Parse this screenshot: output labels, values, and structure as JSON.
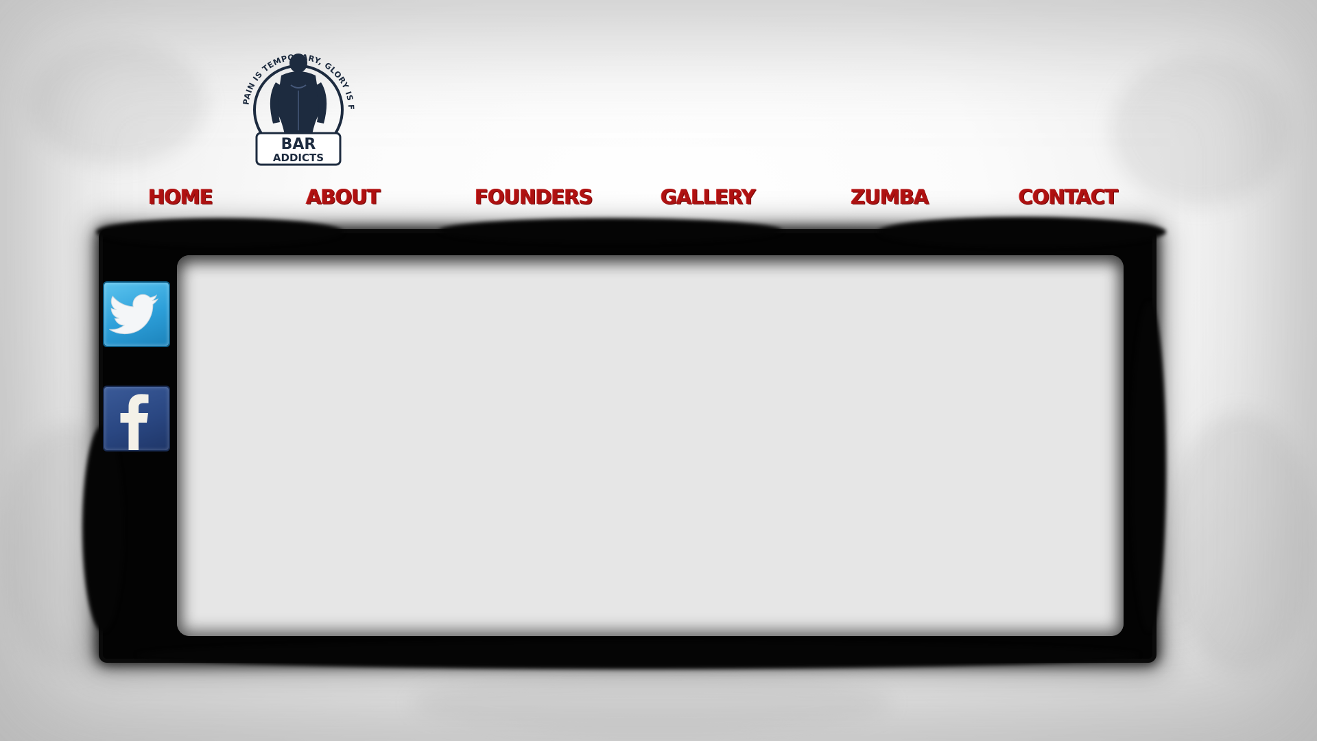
{
  "brand": {
    "name": "BAR ADDICTS",
    "tagline": "PAIN IS TEMPORARY, GLORY IS FOREVER."
  },
  "nav": {
    "items": [
      {
        "label": "HOME"
      },
      {
        "label": "ABOUT"
      },
      {
        "label": "FOUNDERS"
      },
      {
        "label": "GALLERY"
      },
      {
        "label": "ZUMBA"
      },
      {
        "label": "CONTACT"
      }
    ]
  },
  "social": {
    "twitter_icon": "twitter-bird-icon",
    "facebook_icon": "facebook-f-icon"
  },
  "colors": {
    "nav_text": "#b01212",
    "frame": "#030303",
    "screen": "#e6e6e6",
    "twitter": "#2d9fd9",
    "facebook": "#2a4782",
    "logo": "#1d2b3f"
  }
}
